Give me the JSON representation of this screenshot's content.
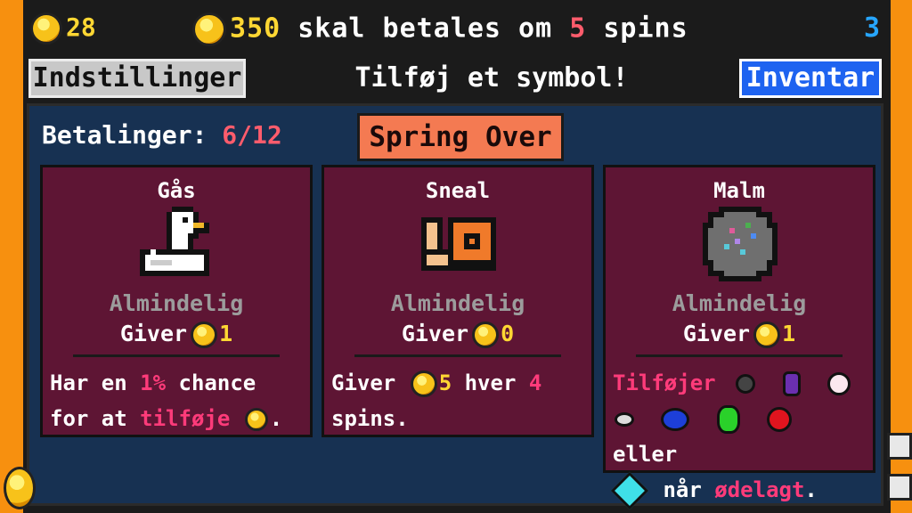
{
  "top": {
    "coins": "28",
    "due_amount": "350",
    "due_text_1": "skal betales om",
    "due_spins": "5",
    "due_text_2": "spins",
    "rent_counter": "3"
  },
  "buttons": {
    "settings": "Indstillinger",
    "message": "Tilføj et symbol!",
    "inventory": "Inventar"
  },
  "panel": {
    "payments_label": "Betalinger:",
    "payments_value": "6/12",
    "skip_button": "Spring Over"
  },
  "cards": [
    {
      "name": "Gås",
      "rarity": "Almindelig",
      "gives_label": "Giver",
      "gives_value": "1",
      "icon": "goose-icon",
      "desc": {
        "w1": "Har en",
        "chance": "1%",
        "w2": "chance",
        "w3": "for at",
        "add": "tilføje",
        "end": "."
      }
    },
    {
      "name": "Sneal",
      "rarity": "Almindelig",
      "gives_label": "Giver",
      "gives_value": "0",
      "icon": "snail-icon",
      "desc": {
        "w1": "Giver",
        "amount": "5",
        "w2": "hver",
        "n": "4",
        "w3": "spins."
      }
    },
    {
      "name": "Malm",
      "rarity": "Almindelig",
      "gives_label": "Giver",
      "gives_value": "1",
      "icon": "ore-icon",
      "desc": {
        "adds": "Tilføjer",
        "or": "eller",
        "when": "når",
        "broken": "ødelagt",
        "end": "."
      }
    }
  ],
  "colors": {
    "panel": "#173152",
    "card": "#5e1534",
    "accent_red": "#ff5c6c",
    "accent_pink": "#ff3b7a",
    "settings_bg": "#c8c8c8",
    "inventory_bg": "#1e63f0",
    "skip_bg": "#f47a52"
  }
}
